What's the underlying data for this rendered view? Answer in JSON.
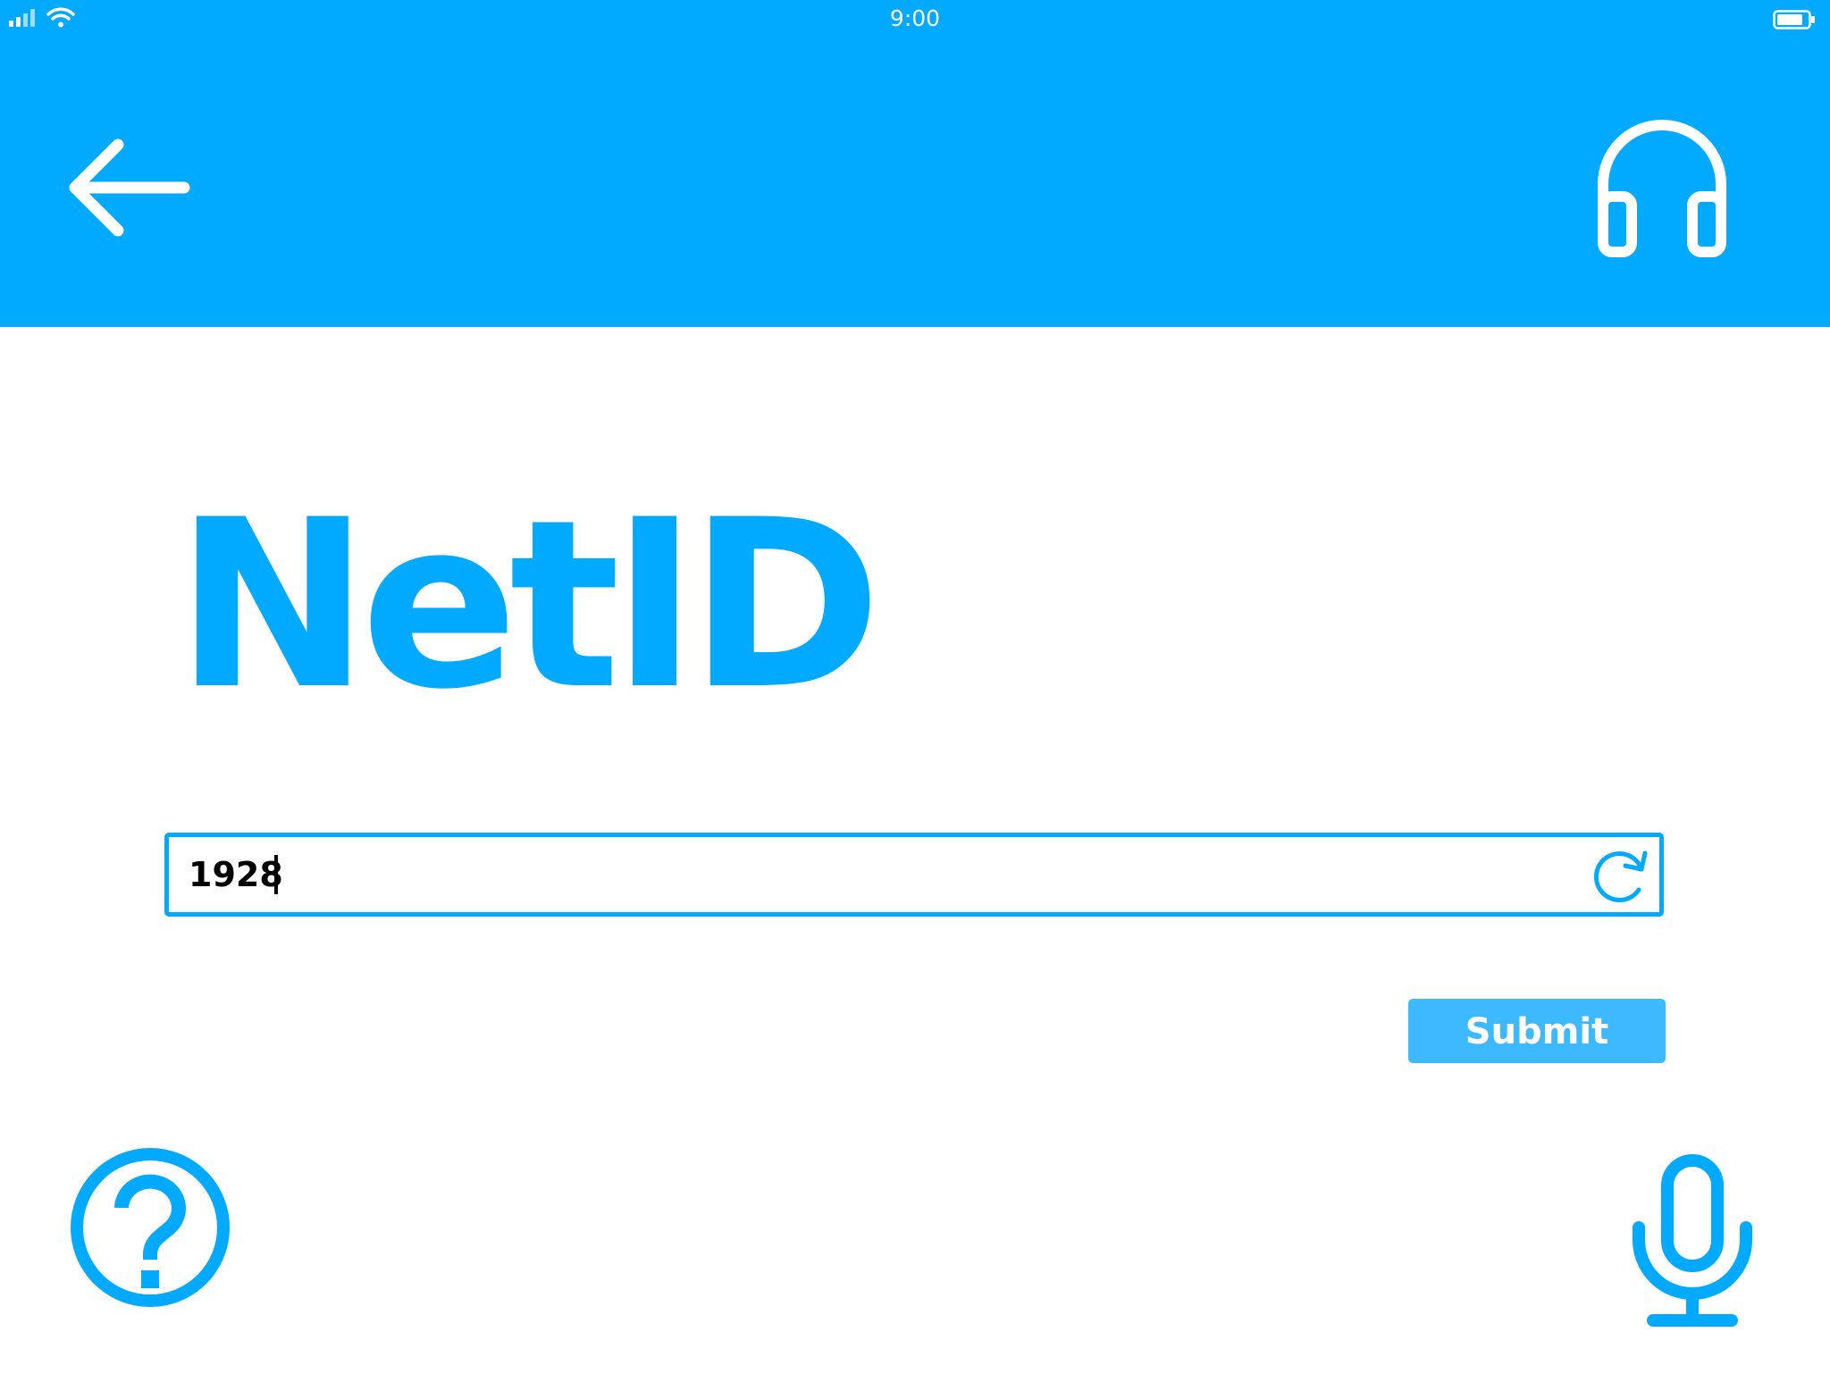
{
  "status_bar": {
    "time": "9:00"
  },
  "header": {
    "back_icon": "arrow-left-icon",
    "support_icon": "headphones-icon"
  },
  "main": {
    "title": "NetID",
    "input": {
      "value": "1928",
      "refresh_icon": "refresh-icon"
    },
    "submit_label": "Submit"
  },
  "footer": {
    "help_icon": "question-circle-icon",
    "mic_icon": "microphone-icon"
  },
  "colors": {
    "brand": "#02aaff",
    "button": "#3dbaff",
    "text": "#000000",
    "background": "#ffffff"
  }
}
